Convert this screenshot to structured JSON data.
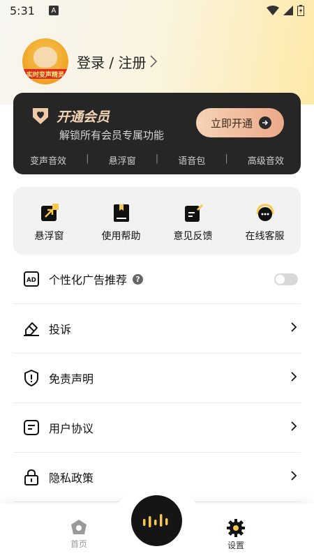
{
  "status_bar": {
    "time": "5:31",
    "indicator": "A",
    "icons": [
      "wifi-icon",
      "signal-icon",
      "battery-icon"
    ]
  },
  "profile": {
    "avatar_banner": "实时变声精灵",
    "login_text": "登录 / 注册"
  },
  "vip": {
    "title": "开通会员",
    "subtitle": "解锁所有会员专属功能",
    "button_label": "立即开通",
    "features": [
      "变声音效",
      "悬浮窗",
      "语音包",
      "高级音效"
    ],
    "accent_color": "#f3d4b2"
  },
  "tools": [
    {
      "label": "悬浮窗",
      "icon": "floating-window-icon"
    },
    {
      "label": "使用帮助",
      "icon": "help-book-icon"
    },
    {
      "label": "意见反馈",
      "icon": "feedback-icon"
    },
    {
      "label": "在线客服",
      "icon": "customer-service-icon"
    }
  ],
  "settings": [
    {
      "label": "个性化广告推荐",
      "icon": "ad-icon",
      "help": "?",
      "toggle": false
    },
    {
      "label": "投诉",
      "icon": "complaint-icon"
    },
    {
      "label": "免责声明",
      "icon": "shield-icon"
    },
    {
      "label": "用户协议",
      "icon": "agreement-icon"
    },
    {
      "label": "隐私政策",
      "icon": "lock-icon"
    }
  ],
  "nav": {
    "home_label": "首页",
    "settings_label": "设置",
    "active": "设置"
  }
}
